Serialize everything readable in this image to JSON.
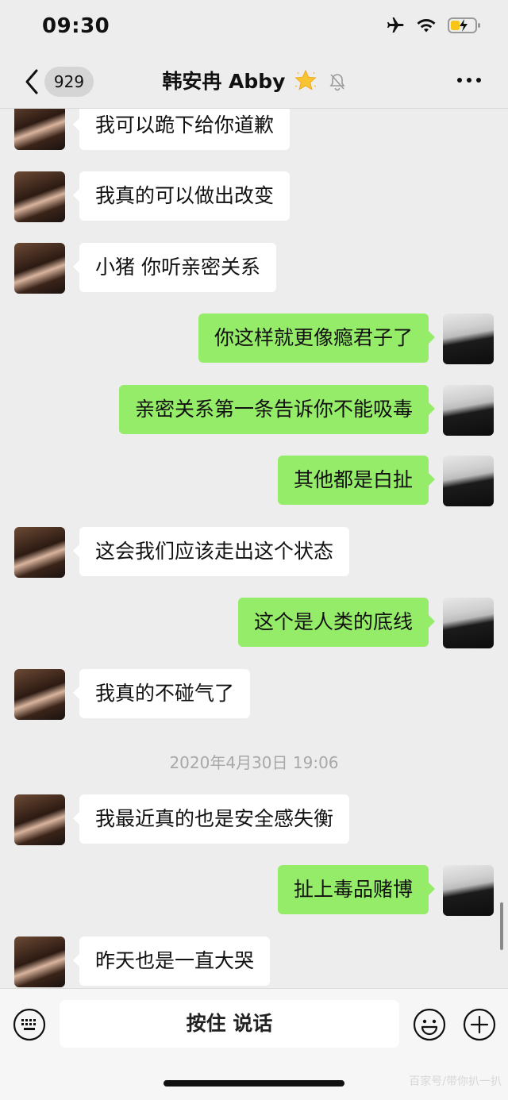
{
  "status_bar": {
    "time": "09:30",
    "icons": [
      "airplane-icon",
      "wifi-icon",
      "battery-charging-icon"
    ]
  },
  "nav": {
    "unread_count": "929",
    "title": "韩安冉 Abby",
    "title_emoji": "star-icon",
    "muted": true
  },
  "messages": [
    {
      "side": "left",
      "text": "我可以跪下给你道歉"
    },
    {
      "side": "left",
      "text": "我真的可以做出改变"
    },
    {
      "side": "left",
      "text": "小猪 你听亲密关系"
    },
    {
      "side": "right",
      "text": "你这样就更像瘾君子了"
    },
    {
      "side": "right",
      "text": "亲密关系第一条告诉你不能吸毒"
    },
    {
      "side": "right",
      "text": "其他都是白扯"
    },
    {
      "side": "left",
      "text": "这会我们应该走出这个状态"
    },
    {
      "side": "right",
      "text": "这个是人类的底线"
    },
    {
      "side": "left",
      "text": "我真的不碰气了"
    },
    {
      "side": "left",
      "text": "我最近真的也是安全感失衡"
    },
    {
      "side": "right",
      "text": "扯上毒品赌博"
    },
    {
      "side": "left",
      "text": "昨天也是一直大哭"
    }
  ],
  "timestamp": "2020年4月30日 19:06",
  "input_bar": {
    "voice_label": "按住 说话"
  },
  "watermark": "百家号/带你扒一扒",
  "colors": {
    "background": "#ededed",
    "outgoing_bubble": "#95ec69",
    "incoming_bubble": "#ffffff"
  }
}
